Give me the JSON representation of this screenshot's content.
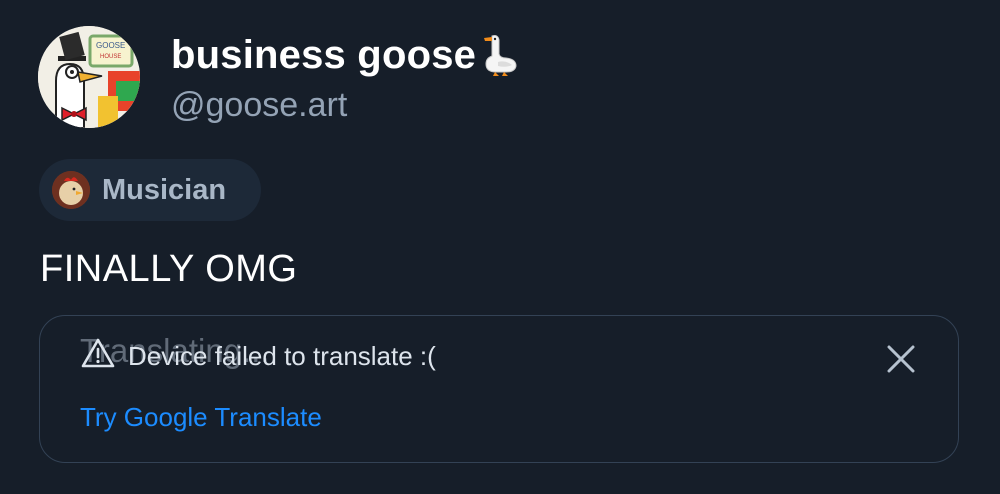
{
  "author": {
    "display_name": "business goose",
    "handle": "@goose.art",
    "avatar": "goose-in-top-hat-avatar",
    "name_emoji": "goose-emoji"
  },
  "label": {
    "text": "Musician",
    "avatar": "rooster-avatar"
  },
  "post": {
    "text": "FINALLY OMG"
  },
  "translation": {
    "ghost_status": "Translating...",
    "error_message": "Device failed to translate :(",
    "fallback_link": "Try Google Translate",
    "icon": "warning-icon",
    "close_icon": "close-icon"
  },
  "colors": {
    "background": "#161e29",
    "handle": "#94a3b5",
    "link": "#1c8cff",
    "card_border": "#334255",
    "pill_bg": "#1d2938"
  }
}
